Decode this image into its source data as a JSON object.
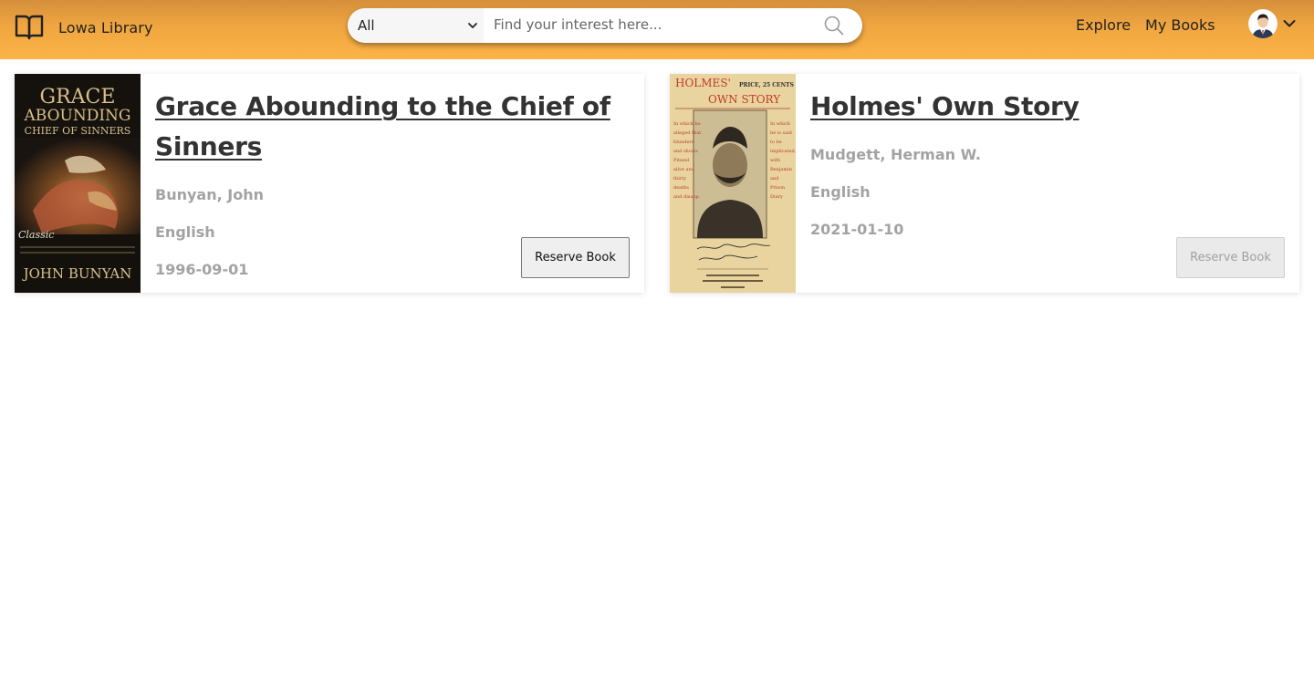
{
  "header": {
    "brand_name": "Lowa Library",
    "brand_icon": "open-book-icon",
    "search": {
      "category_selected": "All",
      "placeholder": "Find your interest here...",
      "search_icon": "magnifier-icon"
    },
    "nav": {
      "explore": "Explore",
      "my_books": "My Books"
    },
    "user": {
      "avatar_icon": "user-avatar",
      "menu_icon": "chevron-down-icon"
    },
    "gradient_colors": [
      "#d68f3c",
      "#fcb347"
    ]
  },
  "books": [
    {
      "title": "Grace Abounding to the Chief of Sinners",
      "author": "Bunyan, John",
      "language": "English",
      "date": "1996-09-01",
      "reserve_label": "Reserve Book",
      "reserve_enabled": true,
      "cover": {
        "title_line1": "GRACE",
        "title_line2": "ABOUNDING",
        "title_line3": "CHIEF OF SINNERS",
        "series": "Classic",
        "author": "JOHN BUNYAN"
      }
    },
    {
      "title": "Holmes' Own Story",
      "author": "Mudgett, Herman W.",
      "language": "English",
      "date": "2021-01-10",
      "reserve_label": "Reserve Book",
      "reserve_enabled": false,
      "cover": {
        "title_line1": "HOLMES'",
        "title_line2": "OWN STORY",
        "price": "PRICE, 25 CENTS"
      }
    }
  ]
}
